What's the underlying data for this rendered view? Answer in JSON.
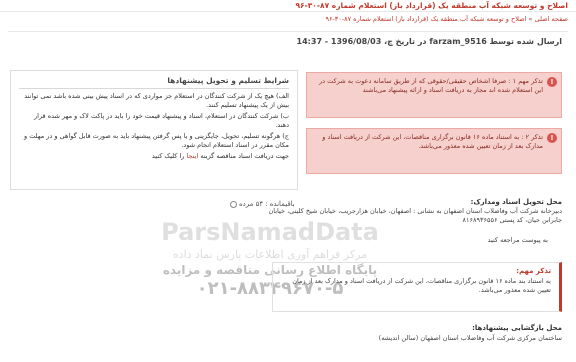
{
  "header": {
    "top_title": "اصلاح و توسعه شبکه آب منطقه یک (قرارداد باز) استعلام شماره ۸۷-۳۰-۹۶"
  },
  "breadcrumb": {
    "home": "صفحه اصلی",
    "separator": "»",
    "current": "اصلاح و توسعه شبکه آب منطقه یک (قرارداد باز) استعلام شماره ۸۷-۳۰-۹۶"
  },
  "send_info": "ارسال شده توسط farzam_9516 در تاریخ چ، 1396/08/03 - 14:37",
  "notices": [
    {
      "icon": "!",
      "text": "تذکر مهم ۱ : صرفا اشخاص حقیقی/حقوقی که از طریق سامانه دعوت به شرکت در این استعلام شده اند مجاز به دریافت اسناد و ارائه پیشنهاد می‌باشند"
    },
    {
      "icon": "!",
      "text": "تذکر ۲ : به استناد ماده ۱۶ قانون برگزاری مناقصات، این شرکت از دریافت اسناد و مدارک بعد از زمان تعیین شده معذور می‌باشد."
    }
  ],
  "conditions": {
    "title": "شرایط تسلیم و تحویل پیشنهادها",
    "items": [
      "الف) هیچ یک از شرکت کنندگان در استعلام جز مواردی که در اسناد پیش بینی شده باشد نمی توانند بیش از یک پیشنهاد تسلیم کنند.",
      "ب) شرکت کنندگان در استعلام، اسناد و پیشنهاد قیمت خود را باید در پاکت لاک و مهر شده قرار دهند.",
      "ج) هرگونه تسلیم، تحویل، جایگزینی و یا پس گرفتن پیشنهاد باید به صورت قابل گواهی و در مهلت و مکان مقرر در اسناد استعلام انجام شود."
    ],
    "link_prefix": "جهت دریافت اسناد مناقصه گزینه",
    "link_label": "اینجا",
    "link_suffix": "را کلیک کنید"
  },
  "remaining": {
    "label": "باقیمانده :",
    "value": "۵۴ مرده"
  },
  "delivery": {
    "label": "محل تحویل اسناد ومدارک:",
    "text": "دبیرخانه شرکت آب وفاضلاب استان اصفهان به نشانی : اصفهان، خیابان هزارجریب، خیابان شیخ کلینی، خیابان جابرابن حیان، کد پستی ۸۱۶۸۹۳۶۵۵۶"
  },
  "attachment_text": "به پیوست مراجعه کنید",
  "watermark": {
    "brand": "ParsNamadData",
    "line2": "مرکز فراهم آوری اطلاعات پارس نماد داده",
    "line3": "پایگاه اطلاع رسانی مناقصه و مزایده",
    "phone": "۰۲۱-۸۸۳۴۹۶۷۰-۵"
  },
  "warning": {
    "title": "تذکر مهم:",
    "text": "به استناد بند ماده ۱۶ قانون برگزاری مناقصات، این شرکت از دریافت اسناد و مدارک بعد از زمان تعیین شده معذور می‌باشد."
  },
  "opening": {
    "label": "محل بازگشایی پیشنهادها:",
    "text": "ساختمان مرکزی شرکت آب وفاضلاب استان اصفهان (سالن اندیشه)"
  },
  "colors": {
    "accent": "#c0392b",
    "notice_bg": "#f6d0cd"
  }
}
